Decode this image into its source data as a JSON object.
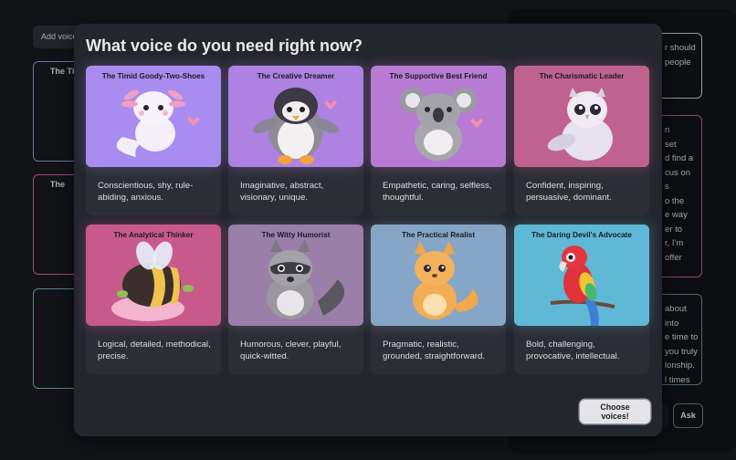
{
  "background": {
    "add_voice_label": "Add voice",
    "left_cards": [
      {
        "label": "The Timid",
        "border": "#8e89d8"
      },
      {
        "label": "The",
        "border": "#c45b8c"
      },
      {
        "label": "",
        "border": "#6fa5b8"
      }
    ],
    "right_messages": [
      {
        "text": "r should\npeople",
        "border": "#b9bbc4"
      },
      {
        "text": "n\nset\nd find a\ncus on\ns\no the\ne way\ner to\nr, I'm\noffer",
        "border": "#a8598a"
      },
      {
        "text": "about\ninto\ne time to\nyou truly\nlonship.\nl times",
        "border": "#5d7d8c"
      }
    ],
    "ask_label": "Ask"
  },
  "modal": {
    "title": "What voice do you need right now?",
    "choose_label": "Choose voices!",
    "voices": [
      {
        "name": "The Timid Goody-Two-Shoes",
        "description": "Conscientious, shy, rule-abiding, anxious.",
        "bg": "#a98cef",
        "creature": "axolotl-icon"
      },
      {
        "name": "The Creative Dreamer",
        "description": "Imaginative, abstract, visionary, unique.",
        "bg": "#ad82e2",
        "creature": "penguin-icon"
      },
      {
        "name": "The Supportive Best Friend",
        "description": "Empathetic, caring, selfless, thoughtful.",
        "bg": "#b77bd3",
        "creature": "koala-icon"
      },
      {
        "name": "The Charismatic Leader",
        "description": "Confident, inspiring, persuasive, dominant.",
        "bg": "#c0628f",
        "creature": "owl-icon"
      },
      {
        "name": "The Analytical Thinker",
        "description": "Logical, detailed, methodical, precise.",
        "bg": "#c75a8a",
        "creature": "bee-icon"
      },
      {
        "name": "The Witty Humorist",
        "description": "Humorous, clever, playful, quick-witted.",
        "bg": "#9a7fa9",
        "creature": "raccoon-icon"
      },
      {
        "name": "The Practical Realist",
        "description": "Pragmatic, realistic, grounded, straightforward.",
        "bg": "#86a6c7",
        "creature": "fox-icon"
      },
      {
        "name": "The Daring Devil's Advocate",
        "description": "Bold, challenging, provocative, intellectual.",
        "bg": "#5fb8d6",
        "creature": "parrot-icon"
      }
    ]
  }
}
